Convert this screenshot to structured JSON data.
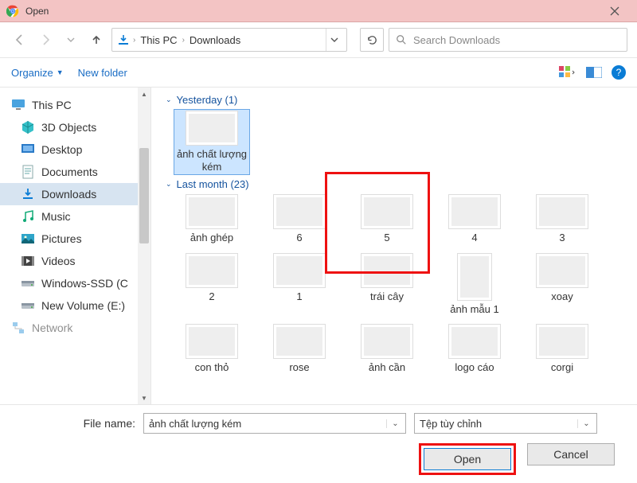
{
  "titlebar": {
    "title": "Open"
  },
  "nav": {
    "breadcrumb": [
      "This PC",
      "Downloads"
    ],
    "search_placeholder": "Search Downloads"
  },
  "toolbar": {
    "organize": "Organize",
    "new_folder": "New folder"
  },
  "sidebar": {
    "items": [
      {
        "label": "This PC",
        "icon": "monitor",
        "head": true
      },
      {
        "label": "3D Objects",
        "icon": "cube"
      },
      {
        "label": "Desktop",
        "icon": "desktop"
      },
      {
        "label": "Documents",
        "icon": "doc"
      },
      {
        "label": "Downloads",
        "icon": "download",
        "selected": true
      },
      {
        "label": "Music",
        "icon": "music"
      },
      {
        "label": "Pictures",
        "icon": "picture"
      },
      {
        "label": "Videos",
        "icon": "video"
      },
      {
        "label": "Windows-SSD (C",
        "icon": "drive"
      },
      {
        "label": "New Volume (E:)",
        "icon": "drive"
      },
      {
        "label": "Network",
        "icon": "network",
        "head": true,
        "faded": true
      }
    ]
  },
  "content": {
    "groups": [
      {
        "header": "Yesterday (1)",
        "startIndex": 0,
        "count": 1
      },
      {
        "header": "Last month (23)",
        "startIndex": 1,
        "count": 10
      }
    ],
    "files": [
      {
        "name": "ảnh chất lượng kém",
        "thumb": "th-girl",
        "selected": true
      },
      {
        "name": "ảnh ghép",
        "thumb": "th-green"
      },
      {
        "name": "6",
        "thumb": "th-blue"
      },
      {
        "name": "5",
        "thumb": "th-white"
      },
      {
        "name": "4",
        "thumb": "th-white"
      },
      {
        "name": "3",
        "thumb": "th-white"
      },
      {
        "name": "2",
        "thumb": "th-mix"
      },
      {
        "name": "1",
        "thumb": "th-white"
      },
      {
        "name": "trái cây",
        "thumb": "th-mix"
      },
      {
        "name": "ảnh mẫu 1",
        "thumb": "th-portrait"
      },
      {
        "name": "xoay",
        "thumb": "th-animal"
      },
      {
        "name": "con thỏ",
        "thumb": "th-green2"
      },
      {
        "name": "rose",
        "thumb": "th-pink"
      },
      {
        "name": "ảnh cần",
        "thumb": "th-leaf"
      },
      {
        "name": "logo cáo",
        "thumb": "th-logo"
      },
      {
        "name": "corgi",
        "thumb": "th-dog"
      }
    ]
  },
  "bottom": {
    "file_name_label": "File name:",
    "file_name_value": "ảnh chất lượng kém",
    "filter_label": "Tệp tùy chỉnh",
    "open": "Open",
    "cancel": "Cancel"
  }
}
